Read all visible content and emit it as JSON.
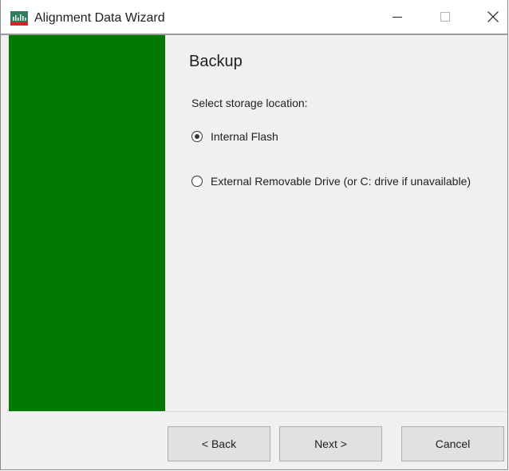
{
  "window": {
    "title": "Alignment Data Wizard",
    "accent_color": "#007a00"
  },
  "titlebar": {
    "minimize_icon": "minimize-icon",
    "maximize_icon": "maximize-icon",
    "close_icon": "close-icon"
  },
  "content": {
    "heading": "Backup",
    "prompt": "Select storage location:",
    "options": [
      {
        "label": "Internal Flash",
        "selected": true
      },
      {
        "label": "External Removable Drive (or C: drive if unavailable)",
        "selected": false
      }
    ]
  },
  "footer": {
    "back_label": "< Back",
    "next_label": "Next >",
    "cancel_label": "Cancel"
  }
}
